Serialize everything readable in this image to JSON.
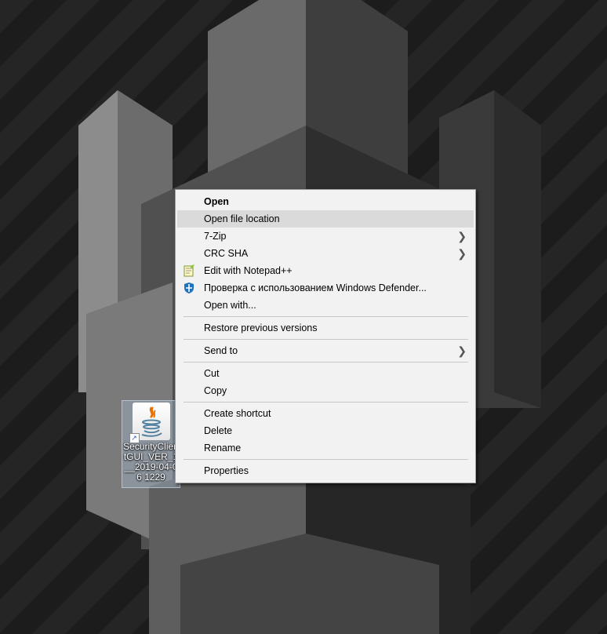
{
  "desktop_icon": {
    "label": "SecurityClientGUI_VER_1__2019-04-06 1229",
    "icon": "java-icon"
  },
  "context_menu": {
    "items": [
      {
        "label": "Open",
        "bold": true
      },
      {
        "label": "Open file location",
        "highlighted": true
      },
      {
        "label": "7-Zip",
        "submenu": true
      },
      {
        "label": "CRC SHA",
        "submenu": true
      },
      {
        "label": "Edit with Notepad++",
        "icon": "notepad-plus-plus-icon"
      },
      {
        "label": "Проверка с использованием Windows Defender...",
        "icon": "windows-defender-icon"
      },
      {
        "label": "Open with..."
      },
      {
        "label": "Restore previous versions"
      },
      {
        "label": "Send to",
        "submenu": true
      },
      {
        "label": "Cut"
      },
      {
        "label": "Copy"
      },
      {
        "label": "Create shortcut"
      },
      {
        "label": "Delete"
      },
      {
        "label": "Rename"
      },
      {
        "label": "Properties"
      }
    ]
  },
  "colors": {
    "menu_background": "#f2f2f2",
    "menu_highlight": "#dadada",
    "desktop_background": "#1a1a1a"
  }
}
